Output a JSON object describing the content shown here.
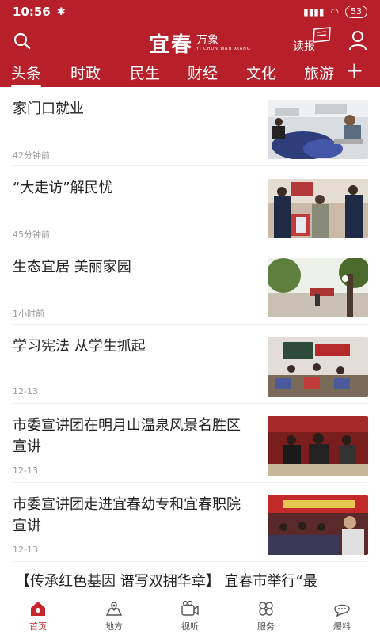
{
  "status_bar": {
    "time": "10:56",
    "bluetooth": "bluetooth-icon",
    "signal": "4G",
    "battery": "53"
  },
  "header": {
    "logo_main": "宜春",
    "logo_sub": "万象",
    "logo_small": "YI CHUN  WAN XIANG",
    "read_label": "读报"
  },
  "tabs": [
    {
      "label": "头条",
      "active": true
    },
    {
      "label": "时政"
    },
    {
      "label": "民生"
    },
    {
      "label": "财经"
    },
    {
      "label": "文化"
    },
    {
      "label": "旅游"
    }
  ],
  "tab_add": "+",
  "news": [
    {
      "title": "家门口就业",
      "time": "42分钟前"
    },
    {
      "title": "“大走访”解民忧",
      "time": "45分钟前"
    },
    {
      "title": "生态宜居 美丽家园",
      "time": "1小时前"
    },
    {
      "title": "学习宪法 从学生抓起",
      "time": "12-13"
    },
    {
      "title": "市委宣讲团在明月山温泉风景名胜区宣讲",
      "time": "12-13"
    },
    {
      "title": "市委宣讲团走进宜春幼专和宜春职院宣讲",
      "time": "12-13"
    }
  ],
  "headline": "【传承红色基因 谱写双拥华章】 宜春市举行“最",
  "bottom_nav": [
    {
      "label": "首页",
      "icon": "home-icon",
      "active": true
    },
    {
      "label": "地方",
      "icon": "map-pin-icon"
    },
    {
      "label": "视听",
      "icon": "video-icon"
    },
    {
      "label": "服务",
      "icon": "services-icon"
    },
    {
      "label": "爆料",
      "icon": "chat-icon"
    }
  ],
  "colors": {
    "brand_red": "#b7202a",
    "active_nav": "#c9252c"
  }
}
